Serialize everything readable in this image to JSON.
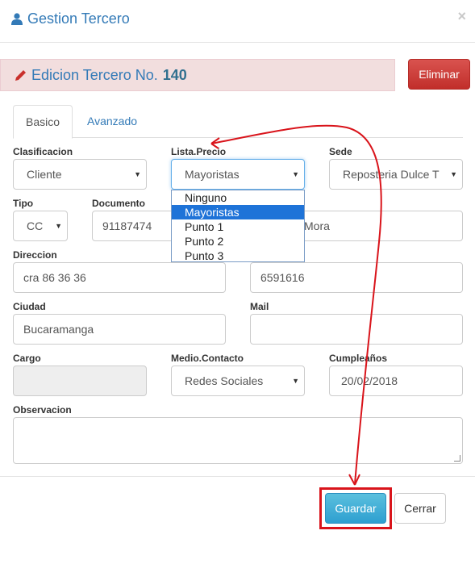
{
  "header": {
    "title": "Gestion Tercero",
    "close": "×"
  },
  "alert": {
    "prefix": "Edicion Tercero No.",
    "number": "140"
  },
  "delete_button": "Eliminar",
  "tabs": [
    {
      "label": "Basico",
      "active": true
    },
    {
      "label": "Avanzado",
      "active": false
    }
  ],
  "form": {
    "clasificacion": {
      "label": "Clasificacion",
      "value": "Cliente"
    },
    "lista_precio": {
      "label": "Lista.Precio",
      "value": "Mayoristas",
      "options": [
        "Ninguno",
        "Mayoristas",
        "Punto 1",
        "Punto 2",
        "Punto 3"
      ],
      "selected_index": 1
    },
    "sede": {
      "label": "Sede",
      "value": "Reposteria Dulce T"
    },
    "tipo": {
      "label": "Tipo",
      "value": "CC"
    },
    "documento": {
      "label": "Documento",
      "value": "91187474"
    },
    "nombre_partial": "Mora",
    "direccion": {
      "label": "Direccion",
      "value": "cra 86 36 36"
    },
    "telefono": {
      "value": "6591616"
    },
    "ciudad": {
      "label": "Ciudad",
      "value": "Bucaramanga"
    },
    "mail": {
      "label": "Mail",
      "value": ""
    },
    "cargo": {
      "label": "Cargo",
      "value": ""
    },
    "medio_contacto": {
      "label": "Medio.Contacto",
      "value": "Redes Sociales"
    },
    "cumpleanos": {
      "label": "Cumpleaños",
      "value": "20/02/2018"
    },
    "observacion": {
      "label": "Observacion",
      "value": ""
    }
  },
  "footer": {
    "save": "Guardar",
    "close": "Cerrar"
  },
  "colors": {
    "accent": "#337ab7",
    "danger": "#c9302c",
    "info": "#5bc0de",
    "annotation": "#d9141b"
  }
}
